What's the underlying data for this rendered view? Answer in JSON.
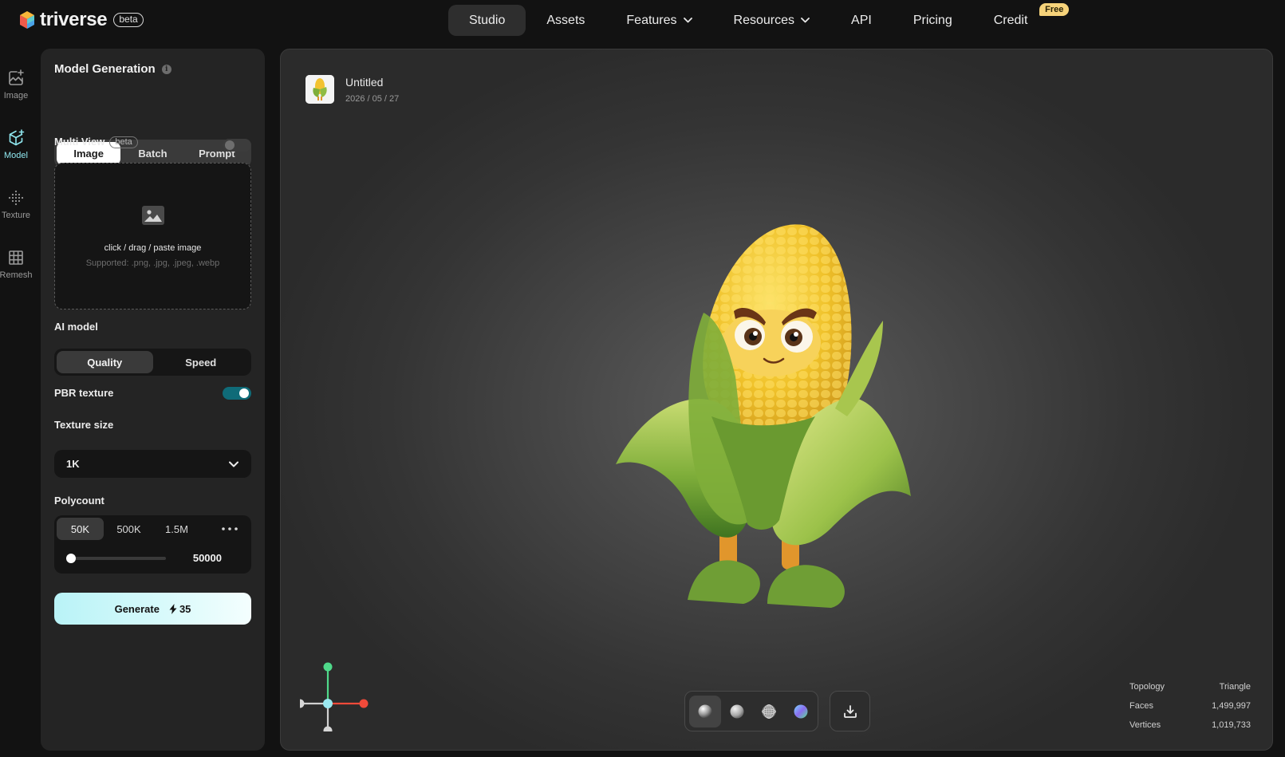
{
  "brand": {
    "name": "triverse",
    "badge": "beta"
  },
  "nav": {
    "items": [
      {
        "label": "Studio",
        "active": true
      },
      {
        "label": "Assets"
      },
      {
        "label": "Features",
        "dropdown": true
      },
      {
        "label": "Resources",
        "dropdown": true
      },
      {
        "label": "API"
      },
      {
        "label": "Pricing"
      },
      {
        "label": "Credit",
        "badge": "Free"
      }
    ]
  },
  "rail": {
    "items": [
      {
        "label": "Image",
        "icon": "image-plus-icon"
      },
      {
        "label": "Model",
        "icon": "cube-plus-icon",
        "active": true
      },
      {
        "label": "Texture",
        "icon": "dots-texture-icon"
      },
      {
        "label": "Remesh",
        "icon": "grid-icon"
      }
    ]
  },
  "panel": {
    "title": "Model Generation",
    "info_icon": "i",
    "mode_tabs": [
      {
        "label": "Image",
        "active": true
      },
      {
        "label": "Batch"
      },
      {
        "label": "Prompt"
      }
    ],
    "multi_view": {
      "label": "Multi View",
      "badge": "beta",
      "enabled": false
    },
    "upload": {
      "text": "click / drag / paste image",
      "supported": "Supported: .png, .jpg, .jpeg, .webp"
    },
    "ai_model": {
      "label": "AI model",
      "options": [
        {
          "label": "Quality",
          "active": true
        },
        {
          "label": "Speed"
        }
      ]
    },
    "pbr_texture": {
      "label": "PBR texture",
      "enabled": true
    },
    "texture_size": {
      "label": "Texture size",
      "value": "1K"
    },
    "polycount": {
      "label": "Polycount",
      "options": [
        "50K",
        "500K",
        "1.5M"
      ],
      "selected": "50K",
      "more_icon": "more-horizontal-icon",
      "value": "50000",
      "slider_fraction": 0.0
    },
    "generate": {
      "label": "Generate",
      "cost": "35",
      "cost_icon": "lightning-icon"
    }
  },
  "viewport": {
    "file": {
      "name": "Untitled",
      "date": "2026 / 05 / 27"
    },
    "tools": [
      {
        "name": "shaded-sphere-icon",
        "active": true
      },
      {
        "name": "clay-sphere-icon"
      },
      {
        "name": "wireframe-sphere-icon"
      },
      {
        "name": "normal-sphere-icon"
      }
    ],
    "download_icon": "download-icon",
    "stats": [
      {
        "label": "Topology",
        "value": "Triangle"
      },
      {
        "label": "Faces",
        "value": "1,499,997"
      },
      {
        "label": "Vertices",
        "value": "1,019,733"
      }
    ]
  },
  "colors": {
    "accent": "#8fe6ee",
    "toggle_on": "#0f6b78",
    "badge": "#f6d37a",
    "axis_x": "#f04a3a",
    "axis_y": "#4fd98a",
    "axis_center": "#9ae8ef"
  }
}
